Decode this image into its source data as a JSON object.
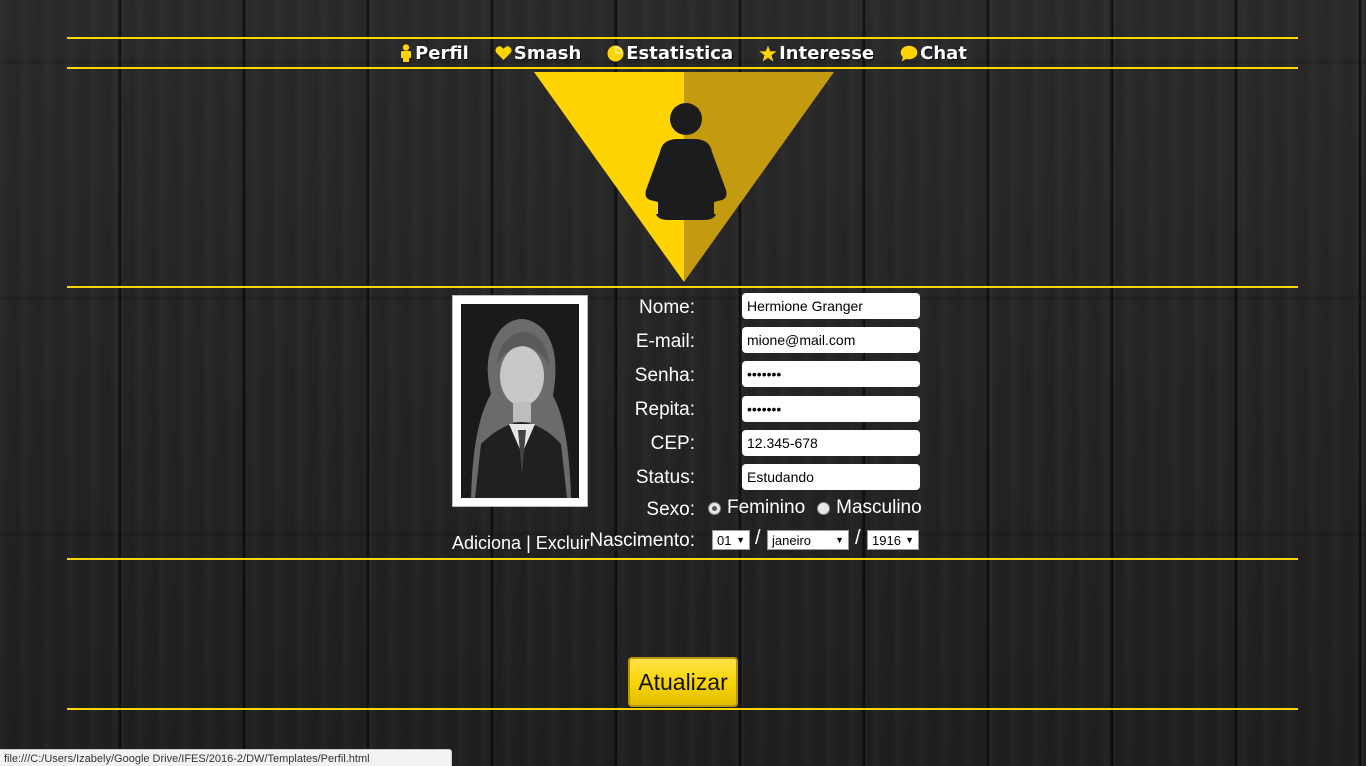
{
  "nav": {
    "items": [
      {
        "label": "Perfil",
        "icon": "person-icon"
      },
      {
        "label": "Smash",
        "icon": "heart-icon"
      },
      {
        "label": "Estatistica",
        "icon": "pie-chart-icon"
      },
      {
        "label": "Interesse",
        "icon": "star-icon"
      },
      {
        "label": "Chat",
        "icon": "chat-bubble-icon"
      }
    ]
  },
  "colors": {
    "accent": "#ffd400",
    "accent_dark": "#c49a0e",
    "background": "#242424"
  },
  "photo": {
    "add_label": "Adiciona",
    "separator": "|",
    "delete_label": "Excluir"
  },
  "form": {
    "nome": {
      "label": "Nome:",
      "value": "Hermione Granger"
    },
    "email": {
      "label": "E-mail:",
      "value": "mione@mail.com"
    },
    "senha": {
      "label": "Senha:",
      "value": "•••••••"
    },
    "repita": {
      "label": "Repita:",
      "value": "•••••••"
    },
    "cep": {
      "label": "CEP:",
      "value": "12.345-678"
    },
    "status": {
      "label": "Status:",
      "value": "Estudando"
    },
    "sexo": {
      "label": "Sexo:",
      "options": [
        "Feminino",
        "Masculino"
      ],
      "selected": "Feminino"
    },
    "nascimento": {
      "label": "Nascimento:",
      "day": "01",
      "month": "janeiro",
      "year": "1916",
      "separator": "/"
    }
  },
  "actions": {
    "update_label": "Atualizar"
  },
  "status_bar": {
    "url": "file:///C:/Users/Izabely/Google Drive/IFES/2016-2/DW/Templates/Perfil.html"
  }
}
